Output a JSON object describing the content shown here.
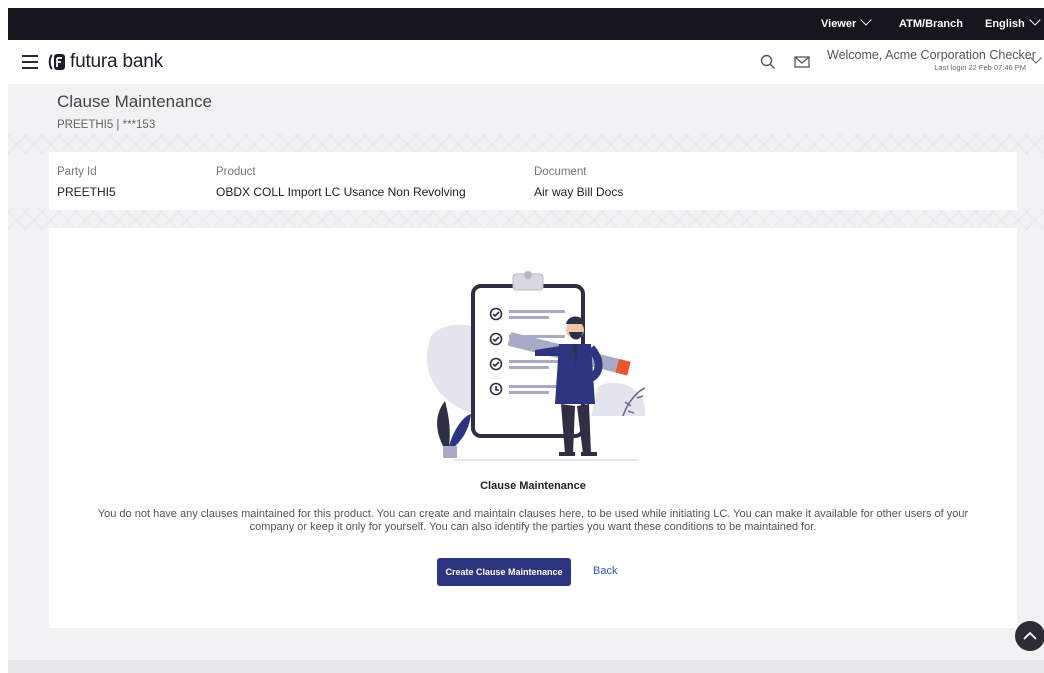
{
  "topbar": {
    "role_label": "Viewer",
    "atm_label": "ATM/Branch",
    "language_label": "English"
  },
  "header": {
    "brand": "futura bank",
    "welcome": "Welcome, Acme Corporation Checker",
    "last_login": "Last login 22 Feb 07:46 PM"
  },
  "page": {
    "title": "Clause Maintenance",
    "subtitle": "PREETHI5 | ***153"
  },
  "info": {
    "party_id_label": "Party Id",
    "party_id_value": "PREETHI5",
    "product_label": "Product",
    "product_value": "OBDX COLL Import LC Usance Non Revolving",
    "document_label": "Document",
    "document_value": "Air way Bill Docs"
  },
  "empty_state": {
    "title": "Clause Maintenance",
    "description": "You do not have any clauses maintained for this product. You can create and maintain clauses here, to be used while initiating LC. You can make it available for other users of your company or keep it only for yourself. You can also identify the parties you want these conditions to be maintained for.",
    "create_button": "Create Clause Maintenance",
    "back_link": "Back"
  },
  "colors": {
    "brand_primary": "#2d3580",
    "topbar": "#16161f",
    "link": "#3553c9",
    "accent_orange": "#e8582c"
  },
  "icons": [
    "hamburger-icon",
    "futura-logo-icon",
    "search-icon",
    "mail-icon",
    "chevron-down-icon",
    "chevron-up-icon"
  ]
}
